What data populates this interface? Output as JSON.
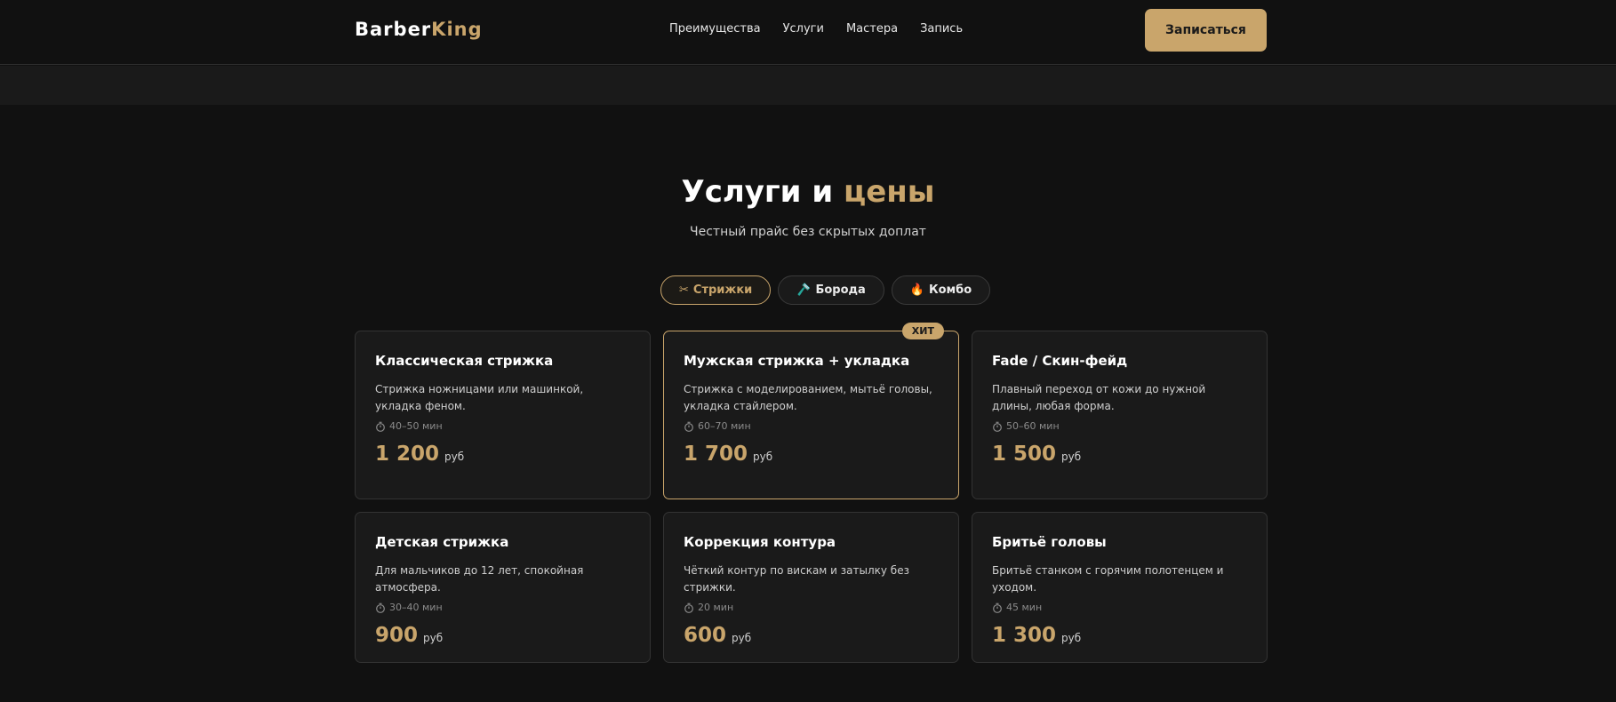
{
  "header": {
    "logo_part1": "Barber",
    "logo_part2": "King",
    "nav": [
      "Преимущества",
      "Услуги",
      "Мастера",
      "Запись"
    ],
    "cta_label": "Записаться"
  },
  "section": {
    "title_main": "Услуги и ",
    "title_accent": "цены",
    "subtitle": "Честный прайс без скрытых доплат"
  },
  "tabs": [
    {
      "icon": "✂",
      "label": "Стрижки",
      "active": true
    },
    {
      "icon": "🪒",
      "label": "Борода",
      "active": false
    },
    {
      "icon": "🔥",
      "label": "Комбо",
      "active": false
    }
  ],
  "cards": [
    {
      "name": "Классическая стрижка",
      "desc": "Стрижка ножницами или машинкой, укладка феном.",
      "time": "40–50 мин",
      "price": "1 200",
      "unit": "руб"
    },
    {
      "name": "Мужская стрижка + укладка",
      "desc": "Стрижка с моделированием, мытьё головы, укладка стайлером.",
      "time": "60–70 мин",
      "price": "1 700",
      "unit": "руб",
      "badge": "ХИТ"
    },
    {
      "name": "Fade / Скин-фейд",
      "desc": "Плавный переход от кожи до нужной длины, любая форма.",
      "time": "50–60 мин",
      "price": "1 500",
      "unit": "руб"
    },
    {
      "name": "Детская стрижка",
      "desc": "Для мальчиков до 12 лет, спокойная атмосфера.",
      "time": "30–40 мин",
      "price": "900",
      "unit": "руб"
    },
    {
      "name": "Коррекция контура",
      "desc": "Чёткий контур по вискам и затылку без стрижки.",
      "time": "20 мин",
      "price": "600",
      "unit": "руб"
    },
    {
      "name": "Бритьё головы",
      "desc": "Бритьё станком с горячим полотенцем и уходом.",
      "time": "45 мин",
      "price": "1 300",
      "unit": "руб"
    }
  ],
  "colors": {
    "accent": "#c9a56b",
    "background": "#111111",
    "card": "#1a1a1a"
  },
  "icons": {
    "timer": "stopwatch-icon"
  }
}
